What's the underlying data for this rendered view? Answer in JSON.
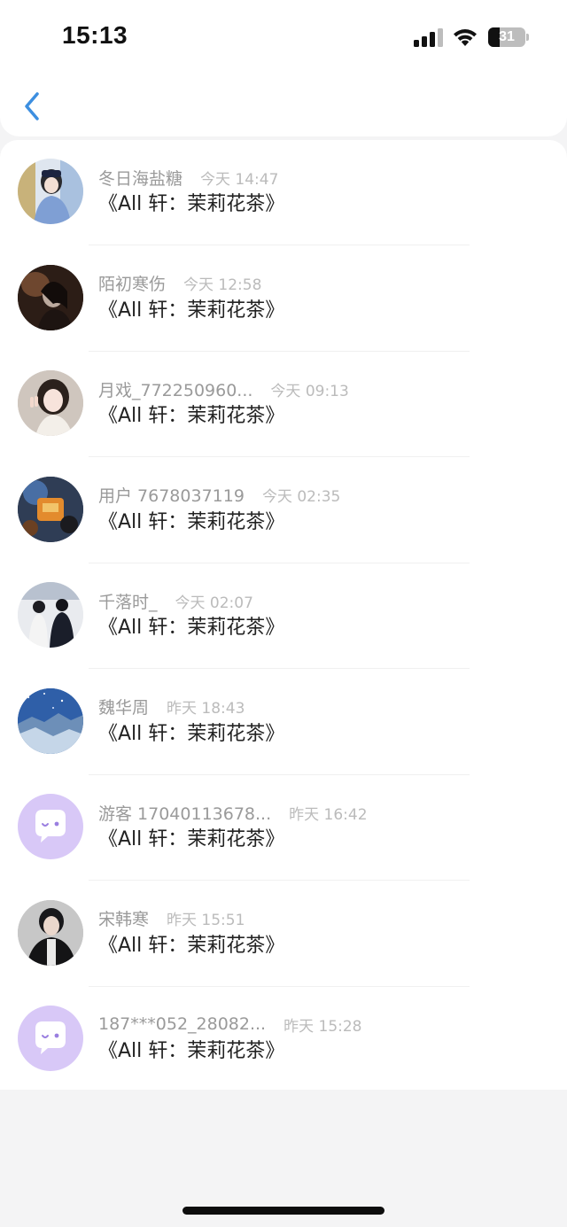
{
  "status_bar": {
    "time": "15:13",
    "battery_level": "31",
    "battery_fraction": 0.31,
    "icons": [
      "signal-icon",
      "wifi-icon",
      "battery-icon"
    ]
  },
  "nav": {
    "back_icon": "chevron-left-icon",
    "accent_color": "#3d8fe0"
  },
  "messages": [
    {
      "name": "冬日海盐糖",
      "time": "今天 14:47",
      "text": "《All 轩：茉莉花茶》",
      "avatar": "photo-girl-cap"
    },
    {
      "name": "陌初寒伤",
      "time": "今天 12:58",
      "text": "《All 轩：茉莉花茶》",
      "avatar": "photo-dark-portrait"
    },
    {
      "name": "月戏_772250960...",
      "time": "今天 09:13",
      "text": "《All 轩：茉莉花茶》",
      "avatar": "photo-girl-peace-sign"
    },
    {
      "name": "用户 7678037119",
      "time": "今天 02:35",
      "text": "《All 轩：茉莉花茶》",
      "avatar": "photo-orange-object"
    },
    {
      "name": "千落时_",
      "time": "今天 02:07",
      "text": "《All 轩：茉莉花茶》",
      "avatar": "photo-two-people"
    },
    {
      "name": "魏华周",
      "time": "昨天 18:43",
      "text": "《All 轩：茉莉花茶》",
      "avatar": "photo-starry-landscape"
    },
    {
      "name": "游客 17040113678...",
      "time": "昨天 16:42",
      "text": "《All 轩：茉莉花茶》",
      "avatar": "default-chat-bubble-icon"
    },
    {
      "name": "宋韩寒",
      "time": "昨天 15:51",
      "text": "《All 轩：茉莉花茶》",
      "avatar": "photo-boy-black-jacket"
    },
    {
      "name": "187***052_28082...",
      "time": "昨天 15:28",
      "text": "《All 轩：茉莉花茶》",
      "avatar": "default-chat-bubble-icon"
    }
  ],
  "colors": {
    "default_avatar_bg": "#d8c8f7",
    "default_avatar_face": "#ffffff",
    "default_avatar_eye": "#9a7fe0"
  }
}
